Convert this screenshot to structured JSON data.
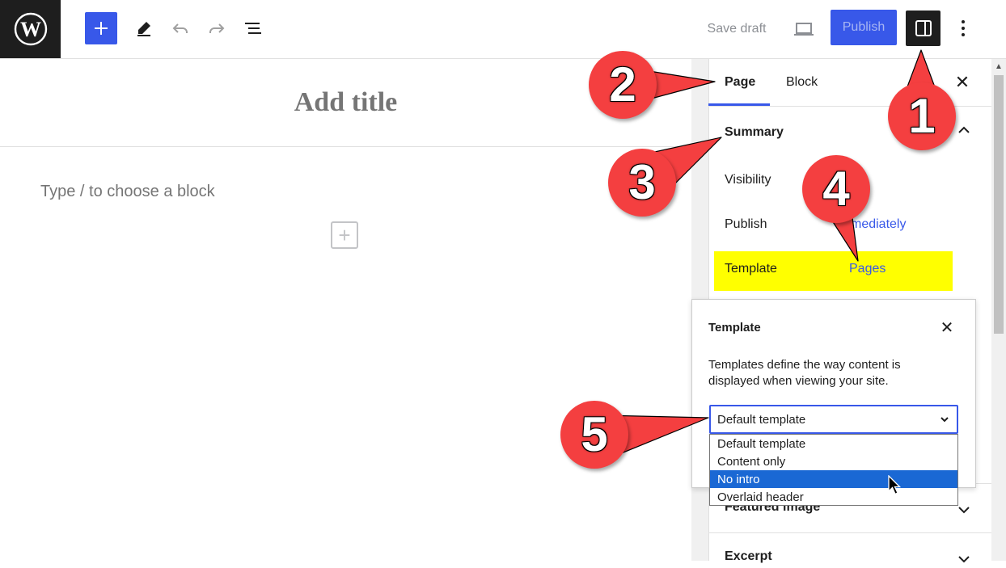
{
  "toolbar": {
    "save_draft_label": "Save draft",
    "publish_label": "Publish",
    "accent_color": "#3858e9"
  },
  "icons": {
    "logo": "wordpress-logo",
    "inserter": "plus-icon",
    "tools": "pen-icon",
    "undo": "undo-icon",
    "redo": "redo-icon",
    "list_view": "list-view-icon",
    "preview": "laptop-icon",
    "settings": "sidebar-icon",
    "more": "kebab-icon"
  },
  "editor": {
    "title_placeholder": "Add title",
    "block_placeholder": "Type / to choose a block",
    "add_block_glyph": "+"
  },
  "sidebar": {
    "tabs": [
      {
        "label": "Page",
        "active": true
      },
      {
        "label": "Block",
        "active": false
      }
    ],
    "close_glyph": "✕",
    "summary": {
      "title": "Summary",
      "rows": [
        {
          "label": "Visibility",
          "value": "lic"
        },
        {
          "label": "Publish",
          "value": "mediately"
        },
        {
          "label": "Template",
          "value": "Pages"
        }
      ]
    },
    "featured_image_label": "Featured image",
    "excerpt_label": "Excerpt"
  },
  "template_popover": {
    "title": "Template",
    "close_glyph": "✕",
    "description": "Templates define the way content is displayed when viewing your site.",
    "selected": "Default template",
    "options": [
      "Default template",
      "Content only",
      "No intro",
      "Overlaid header"
    ],
    "highlighted_option": "No intro"
  },
  "annotations": [
    "1",
    "2",
    "3",
    "4",
    "5"
  ],
  "annotation_color": "#f43f40",
  "highlight_color": "#ffff00"
}
